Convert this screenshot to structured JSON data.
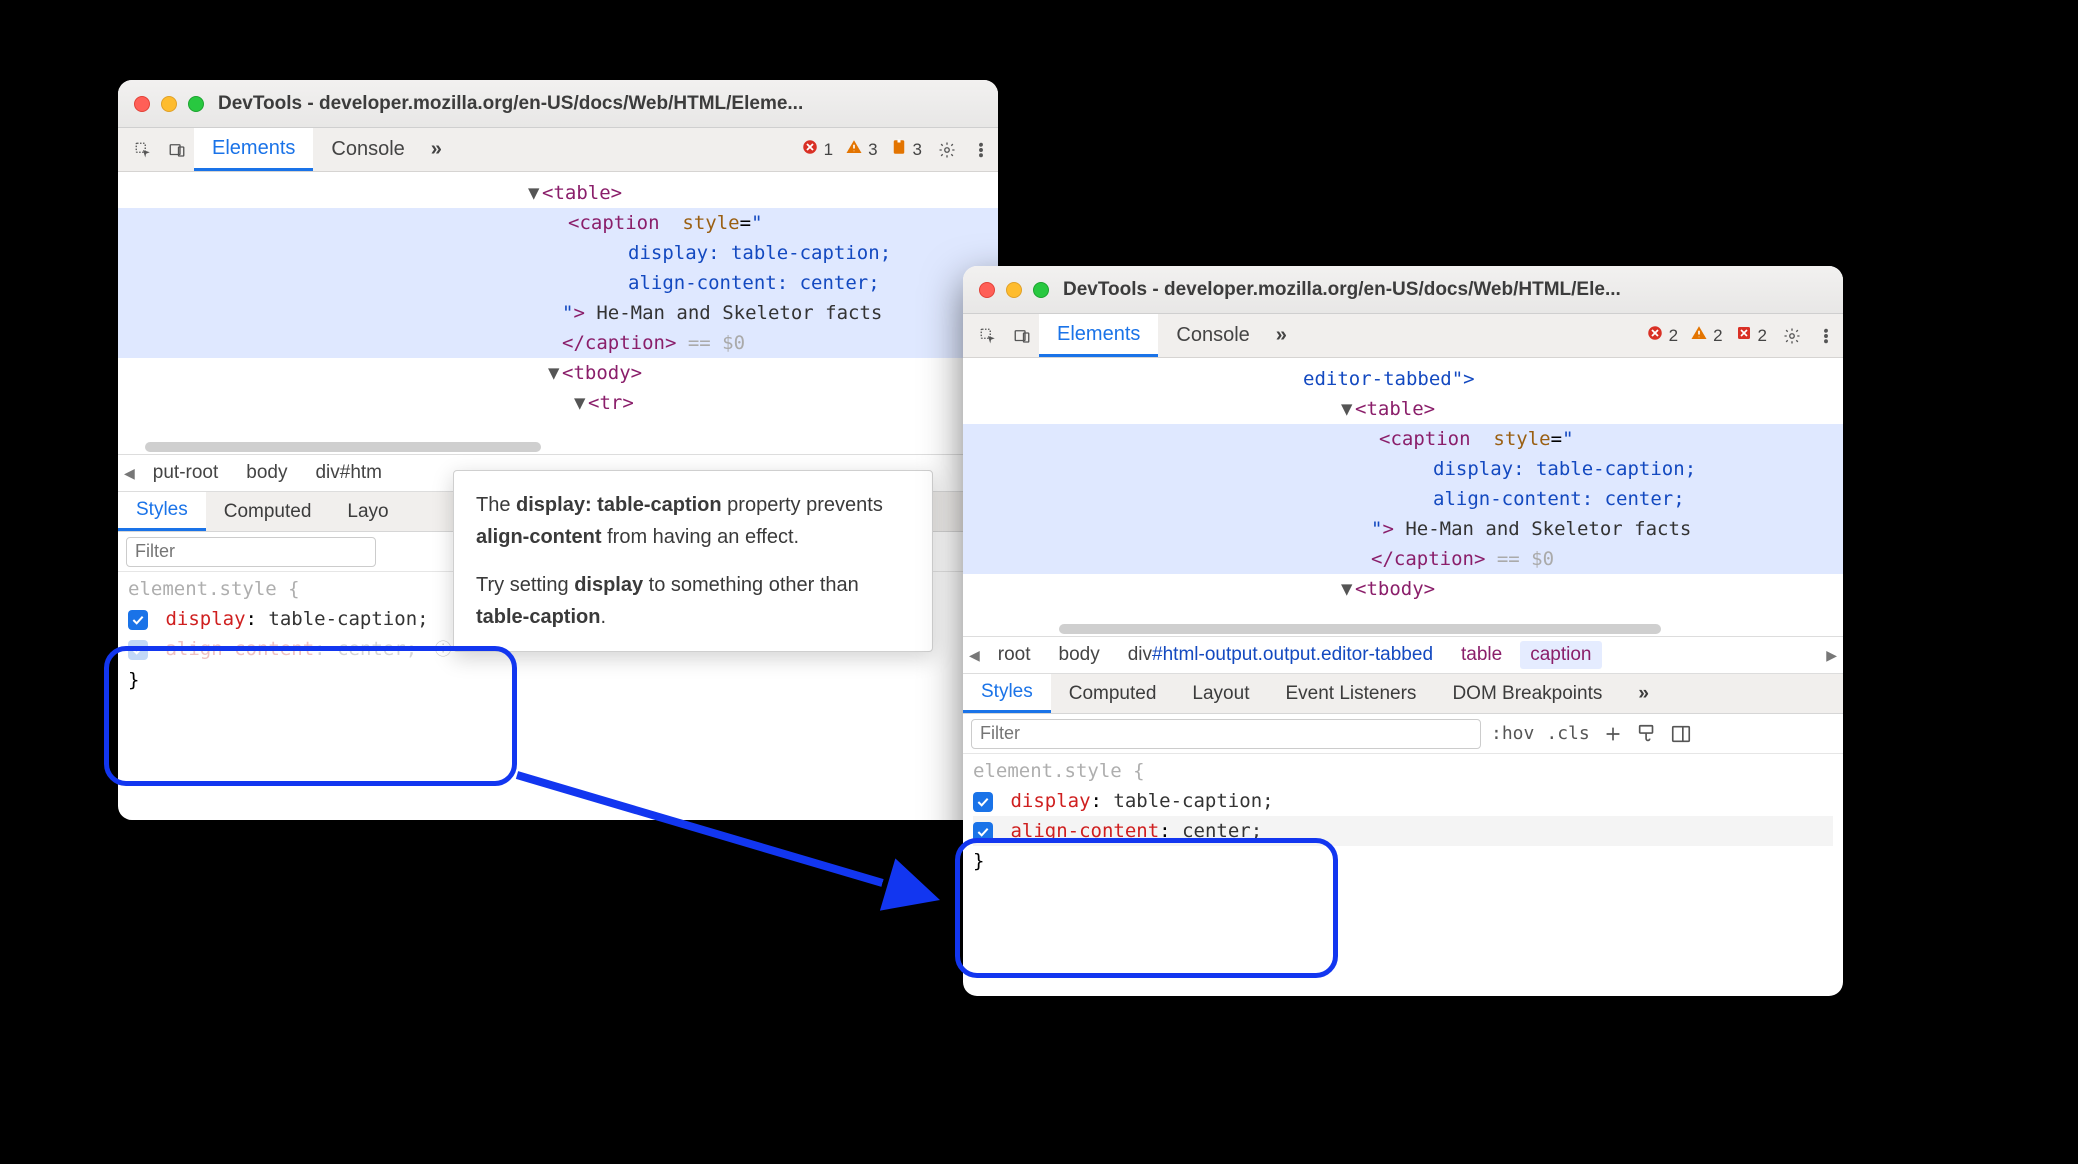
{
  "windows": {
    "left": {
      "title": "DevTools - developer.mozilla.org/en-US/docs/Web/HTML/Eleme...",
      "tabs": {
        "elements": "Elements",
        "console": "Console",
        "more": "»"
      },
      "status": {
        "errors": "1",
        "warnings": "3",
        "issues": "3"
      },
      "tree": {
        "table_open": "<table>",
        "caption_open_1": "<caption",
        "attr_style": "style",
        "style_line1_prop": "display",
        "style_line1_val": "table-caption",
        "style_line2_prop": "align-content",
        "style_line2_val": "center",
        "caption_text": "He-Man and Skeletor facts",
        "caption_close": "</caption>",
        "eq_dollar": "== $0",
        "tbody_open": "<tbody>",
        "tr_open": "<tr>"
      },
      "crumb": {
        "left": "put-root",
        "body": "body",
        "divh": "div#htm"
      },
      "style_tabs": {
        "styles": "Styles",
        "computed": "Computed",
        "layout": "Layo"
      },
      "filter_placeholder": "Filter",
      "element_style_label": "element.style {",
      "rule1": {
        "prop": "display",
        "val": "table-caption;"
      },
      "rule2": {
        "prop": "align-content",
        "val": "center;"
      },
      "close_brace": "}"
    },
    "right": {
      "title": "DevTools - developer.mozilla.org/en-US/docs/Web/HTML/Ele...",
      "tabs": {
        "elements": "Elements",
        "console": "Console",
        "more": "»"
      },
      "status": {
        "errors": "2",
        "warnings": "2",
        "issues": "2"
      },
      "tree": {
        "editor_tabbed": "editor-tabbed\">",
        "table_open": "<table>",
        "caption_open_1": "<caption",
        "attr_style": "style",
        "style_line1_prop": "display",
        "style_line1_val": "table-caption",
        "style_line2_prop": "align-content",
        "style_line2_val": "center",
        "caption_text": "He-Man and Skeletor facts",
        "caption_close": "</caption>",
        "eq_dollar": "== $0",
        "tbody_open": "<tbody>"
      },
      "crumb": {
        "root": "root",
        "body": "body",
        "div": "div#html-output.output.editor-tabbed",
        "table": "table",
        "caption": "caption"
      },
      "style_tabs": {
        "styles": "Styles",
        "computed": "Computed",
        "layout": "Layout",
        "listeners": "Event Listeners",
        "dombp": "DOM Breakpoints",
        "more": "»"
      },
      "filter_placeholder": "Filter",
      "tools": {
        "hov": ":hov",
        "cls": ".cls"
      },
      "element_style_label": "element.style {",
      "rule1": {
        "prop": "display",
        "val": "table-caption;"
      },
      "rule2": {
        "prop": "align-content",
        "val": "center;"
      },
      "close_brace": "}"
    }
  },
  "tooltip": {
    "line1a": "The ",
    "bold1": "display: table-caption",
    "line1b": " property prevents ",
    "bold2": "align-content",
    "line1c": " from having an effect.",
    "line2a": "Try setting ",
    "bold3": "display",
    "line2b": " to something other than ",
    "bold4": "table-caption",
    "line2c": "."
  }
}
